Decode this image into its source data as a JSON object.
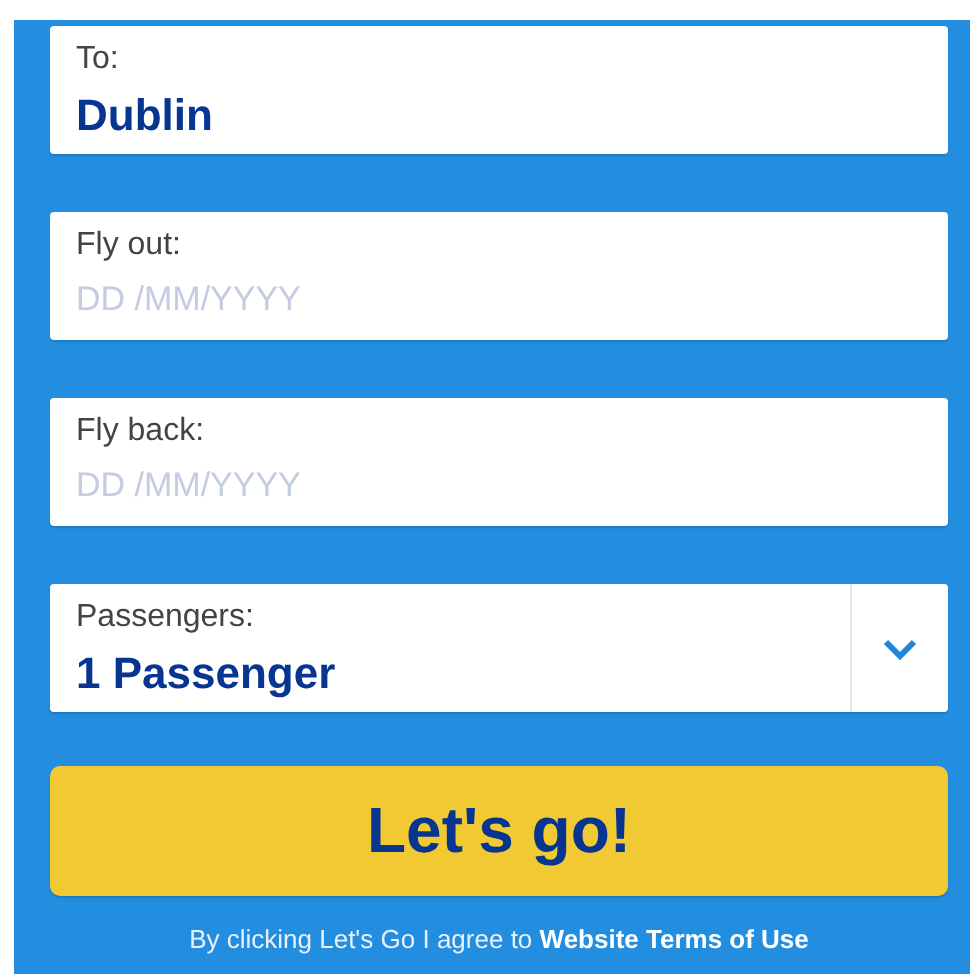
{
  "fields": [
    {
      "kind": "text",
      "label": "To:",
      "value": "Dublin"
    },
    {
      "kind": "date",
      "label": "Fly out:",
      "placeholder": "DD /MM/YYYY"
    },
    {
      "kind": "date",
      "label": "Fly back:",
      "placeholder": "DD /MM/YYYY"
    },
    {
      "kind": "select",
      "label": "Passengers:",
      "value": "1 Passenger"
    }
  ],
  "submit": "Let's go!",
  "terms": {
    "text": "By clicking Let's Go I agree to",
    "link": "Website Terms of Use"
  }
}
